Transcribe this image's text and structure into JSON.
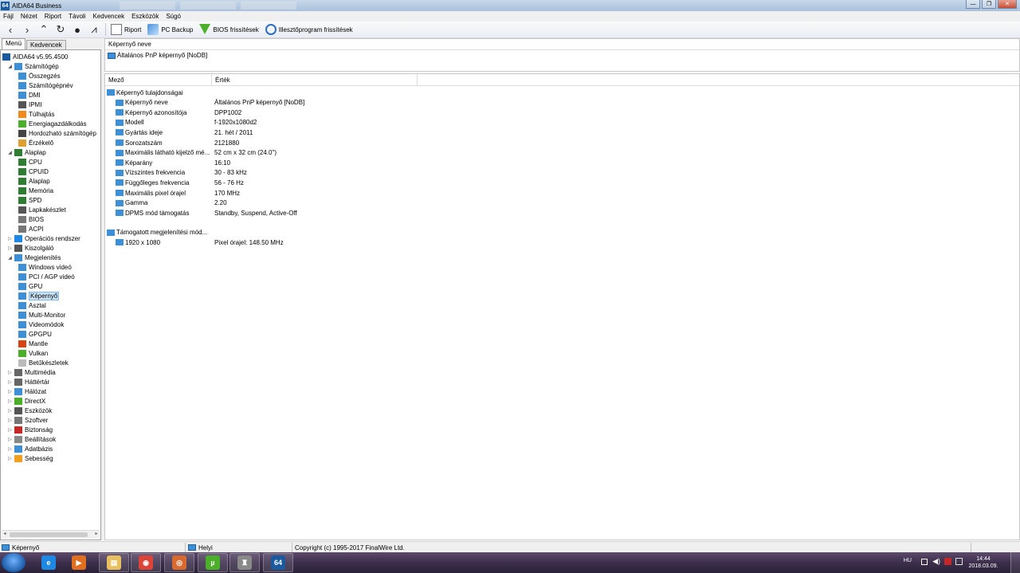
{
  "window": {
    "title": "AIDA64 Business",
    "app_icon_text": "64"
  },
  "menu": [
    "Fájl",
    "Nézet",
    "Riport",
    "Távoli",
    "Kedvencek",
    "Eszközök",
    "Súgó"
  ],
  "toolbar": {
    "buttons": [
      {
        "label": "Riport",
        "icon": "report-icon"
      },
      {
        "label": "PC Backup",
        "icon": "backup-icon"
      },
      {
        "label": "BIOS frissítések",
        "icon": "download-arrow-icon"
      },
      {
        "label": "Illesztőprogram frissítések",
        "icon": "magnifier-icon"
      }
    ]
  },
  "left_tabs": [
    "Menü",
    "Kedvencek"
  ],
  "tree": [
    {
      "label": "AIDA64 v5.95.4500",
      "level": 0,
      "expander": "",
      "icon": "aida64-icon",
      "color": "#1c5a9f"
    },
    {
      "label": "Számítógép",
      "level": 1,
      "expander": "◢",
      "icon": "computer-icon",
      "color": "#3d8fd6"
    },
    {
      "label": "Összegzés",
      "level": 2,
      "expander": "",
      "icon": "monitor-icon",
      "color": "#3d8fd6"
    },
    {
      "label": "Számítógépnév",
      "level": 2,
      "expander": "",
      "icon": "monitor-icon",
      "color": "#3d8fd6"
    },
    {
      "label": "DMI",
      "level": 2,
      "expander": "",
      "icon": "monitor-icon",
      "color": "#3d8fd6"
    },
    {
      "label": "IPMI",
      "level": 2,
      "expander": "",
      "icon": "server-icon",
      "color": "#555555"
    },
    {
      "label": "Túlhajtás",
      "level": 2,
      "expander": "",
      "icon": "flame-icon",
      "color": "#f08a1c"
    },
    {
      "label": "Energiagazdálkodás",
      "level": 2,
      "expander": "",
      "icon": "battery-icon",
      "color": "#4caf2a"
    },
    {
      "label": "Hordozható számítógép",
      "level": 2,
      "expander": "",
      "icon": "laptop-icon",
      "color": "#444444"
    },
    {
      "label": "Érzékelő",
      "level": 2,
      "expander": "",
      "icon": "gauge-icon",
      "color": "#e0a030"
    },
    {
      "label": "Alaplap",
      "level": 1,
      "expander": "◢",
      "icon": "motherboard-icon",
      "color": "#2f7d32"
    },
    {
      "label": "CPU",
      "level": 2,
      "expander": "",
      "icon": "chip-icon",
      "color": "#2f7d32"
    },
    {
      "label": "CPUID",
      "level": 2,
      "expander": "",
      "icon": "chip-icon",
      "color": "#2f7d32"
    },
    {
      "label": "Alaplap",
      "level": 2,
      "expander": "",
      "icon": "motherboard-icon",
      "color": "#2f7d32"
    },
    {
      "label": "Memória",
      "level": 2,
      "expander": "",
      "icon": "ram-icon",
      "color": "#2f7d32"
    },
    {
      "label": "SPD",
      "level": 2,
      "expander": "",
      "icon": "ram-icon",
      "color": "#2f7d32"
    },
    {
      "label": "Lapkakészlet",
      "level": 2,
      "expander": "",
      "icon": "chip-icon",
      "color": "#555555"
    },
    {
      "label": "BIOS",
      "level": 2,
      "expander": "",
      "icon": "chip-icon",
      "color": "#777777"
    },
    {
      "label": "ACPI",
      "level": 2,
      "expander": "",
      "icon": "chip-icon",
      "color": "#777777"
    },
    {
      "label": "Operációs rendszer",
      "level": 1,
      "expander": "▷",
      "icon": "windows-icon",
      "color": "#1e88e5"
    },
    {
      "label": "Kiszolgáló",
      "level": 1,
      "expander": "▷",
      "icon": "server-icon",
      "color": "#555555"
    },
    {
      "label": "Megjelenítés",
      "level": 1,
      "expander": "◢",
      "icon": "monitor-icon",
      "color": "#3d8fd6"
    },
    {
      "label": "Windows videó",
      "level": 2,
      "expander": "",
      "icon": "monitor-icon",
      "color": "#3d8fd6"
    },
    {
      "label": "PCI / AGP videó",
      "level": 2,
      "expander": "",
      "icon": "monitor-icon",
      "color": "#3d8fd6"
    },
    {
      "label": "GPU",
      "level": 2,
      "expander": "",
      "icon": "monitor-icon",
      "color": "#3d8fd6"
    },
    {
      "label": "Képernyő",
      "level": 2,
      "expander": "",
      "icon": "monitor-icon",
      "color": "#3d8fd6",
      "selected": true
    },
    {
      "label": "Asztal",
      "level": 2,
      "expander": "",
      "icon": "monitor-icon",
      "color": "#3d8fd6"
    },
    {
      "label": "Multi-Monitor",
      "level": 2,
      "expander": "",
      "icon": "monitor-icon",
      "color": "#3d8fd6"
    },
    {
      "label": "Videomódok",
      "level": 2,
      "expander": "",
      "icon": "monitor-icon",
      "color": "#3d8fd6"
    },
    {
      "label": "GPGPU",
      "level": 2,
      "expander": "",
      "icon": "database-icon",
      "color": "#3d8fd6"
    },
    {
      "label": "Mantle",
      "level": 2,
      "expander": "",
      "icon": "mantle-icon",
      "color": "#d84315"
    },
    {
      "label": "Vulkan",
      "level": 2,
      "expander": "",
      "icon": "vulkan-icon",
      "color": "#4caf2a"
    },
    {
      "label": "Betűkészletek",
      "level": 2,
      "expander": "",
      "icon": "font-icon",
      "color": "#bbbbbb"
    },
    {
      "label": "Multimédia",
      "level": 1,
      "expander": "▷",
      "icon": "speaker-icon",
      "color": "#666666"
    },
    {
      "label": "Háttértár",
      "level": 1,
      "expander": "▷",
      "icon": "disk-icon",
      "color": "#666666"
    },
    {
      "label": "Hálózat",
      "level": 1,
      "expander": "▷",
      "icon": "network-icon",
      "color": "#3d8fd6"
    },
    {
      "label": "DirectX",
      "level": 1,
      "expander": "▷",
      "icon": "directx-icon",
      "color": "#4caf2a"
    },
    {
      "label": "Eszközök",
      "level": 1,
      "expander": "▷",
      "icon": "device-icon",
      "color": "#555555"
    },
    {
      "label": "Szoftver",
      "level": 1,
      "expander": "▷",
      "icon": "software-icon",
      "color": "#777777"
    },
    {
      "label": "Biztonság",
      "level": 1,
      "expander": "▷",
      "icon": "shield-icon",
      "color": "#c62828"
    },
    {
      "label": "Beállítások",
      "level": 1,
      "expander": "▷",
      "icon": "settings-icon",
      "color": "#888888"
    },
    {
      "label": "Adatbázis",
      "level": 1,
      "expander": "▷",
      "icon": "database-icon",
      "color": "#3d8fd6"
    },
    {
      "label": "Sebesség",
      "level": 1,
      "expander": "▷",
      "icon": "benchmark-icon",
      "color": "#f0a020"
    }
  ],
  "right_top": {
    "header": "Képernyő neve",
    "value": "Általános PnP képernyő [NoDB]"
  },
  "columns": {
    "field": "Mező",
    "value": "Érték"
  },
  "sections": [
    {
      "title": "Képernyő tulajdonságai",
      "rows": [
        {
          "field": "Képernyő neve",
          "value": "Általános PnP képernyő [NoDB]"
        },
        {
          "field": "Képernyő azonosítója",
          "value": "DPP1002"
        },
        {
          "field": "Modell",
          "value": "f-1920x1080d2"
        },
        {
          "field": "Gyártás ideje",
          "value": "21. hét / 2011"
        },
        {
          "field": "Sorozatszám",
          "value": "2121880"
        },
        {
          "field": "Maximális látható kijelző mé...",
          "value": "52 cm x 32 cm (24.0\")"
        },
        {
          "field": "Képarány",
          "value": "16:10"
        },
        {
          "field": "Vízszintes frekvencia",
          "value": "30 - 83 kHz"
        },
        {
          "field": "Függőleges frekvencia",
          "value": "56 - 76 Hz"
        },
        {
          "field": "Maximális pixel órajel",
          "value": "170 MHz"
        },
        {
          "field": "Gamma",
          "value": "2.20"
        },
        {
          "field": "DPMS mód támogatás",
          "value": "Standby, Suspend, Active-Off"
        }
      ]
    },
    {
      "title": "Támogatott megjelenítési mód...",
      "rows": [
        {
          "field": "1920 x 1080",
          "value": "Pixel órajel: 148.50 MHz"
        }
      ]
    }
  ],
  "status": {
    "left": "Képernyő",
    "middle": "Helyi",
    "right": "Copyright (c) 1995-2017 FinalWire Ltd."
  },
  "taskbar": {
    "language": "HU",
    "time": "14:44",
    "date": "2018.03.09.",
    "apps": [
      {
        "name": "ie-icon",
        "glyph": "e",
        "color": "#1e88e5"
      },
      {
        "name": "media-player-icon",
        "glyph": "▶",
        "color": "#e07020"
      },
      {
        "name": "file-explorer-icon",
        "glyph": "▤",
        "color": "#e8c060"
      },
      {
        "name": "chrome-icon",
        "glyph": "◉",
        "color": "#db4437"
      },
      {
        "name": "game-icon",
        "glyph": "◎",
        "color": "#d86a30"
      },
      {
        "name": "utorrent-icon",
        "glyph": "µ",
        "color": "#4caf2a"
      },
      {
        "name": "robot-app-icon",
        "glyph": "♜",
        "color": "#8a8a8a"
      },
      {
        "name": "aida64-taskbar-icon",
        "glyph": "64",
        "color": "#1c5a9f"
      }
    ]
  }
}
